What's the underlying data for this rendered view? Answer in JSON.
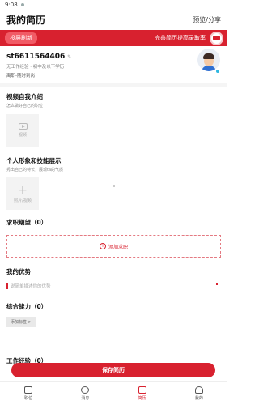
{
  "status_bar": {
    "time": "9:08"
  },
  "header": {
    "title": "我的简历",
    "action": "预览/分享"
  },
  "banner": {
    "refresh_label": "投屏刷新",
    "tip": "完善简历提高录取率"
  },
  "profile": {
    "name": "st6611564406",
    "meta": "无工作经验 · 初中及以下学历",
    "meta2": "离职-随时到岗"
  },
  "video_intro": {
    "title": "视频自我介绍",
    "subtitle": "怎么做好自己的职位",
    "box_label": "视频"
  },
  "image_skills": {
    "title": "个人形象和技能展示",
    "subtitle": "秀出自己的特长，展现ta的气质",
    "box_label": "照片/视频"
  },
  "job_expectation": {
    "title": "求职期望（0）",
    "add_label": "添加求职"
  },
  "advantages": {
    "title": "我的优势",
    "placeholder": "说简单描述你的优势"
  },
  "abilities": {
    "title": "综合能力（0）",
    "chip_label": "添加标签 >"
  },
  "work_experience": {
    "title": "工作经验（0）"
  },
  "save_button": "保存简历",
  "tabs": [
    {
      "label": "职位",
      "icon": "briefcase-icon"
    },
    {
      "label": "消息",
      "icon": "chat-icon"
    },
    {
      "label": "简历",
      "icon": "resume-icon",
      "active": true
    },
    {
      "label": "我的",
      "icon": "person-icon"
    }
  ],
  "colors": {
    "accent": "#d8212f",
    "banner": "#d8212f"
  }
}
